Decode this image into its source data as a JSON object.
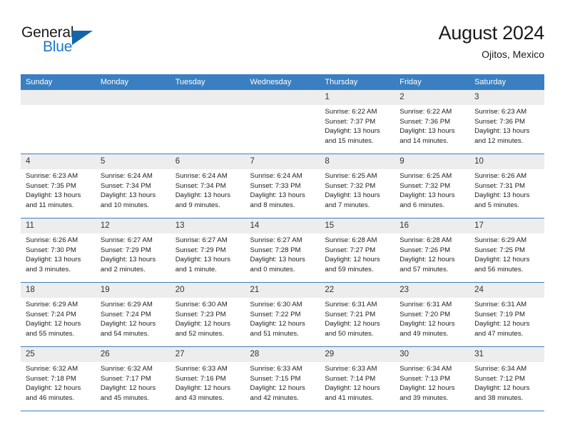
{
  "brand": {
    "line1": "General",
    "line2": "Blue",
    "triangle_icon": "blue-triangle-icon",
    "color_dark": "#1a1a1a",
    "color_blue": "#1e78c8"
  },
  "header": {
    "title": "August 2024",
    "subtitle": "Ojitos, Mexico"
  },
  "theme": {
    "header_row_bg": "#3a7fc1",
    "daynum_bg": "#ededed",
    "grid_line": "#3a7fc1",
    "text": "#222222"
  },
  "weekdays": [
    "Sunday",
    "Monday",
    "Tuesday",
    "Wednesday",
    "Thursday",
    "Friday",
    "Saturday"
  ],
  "weeks": [
    [
      {
        "day": "",
        "blank": true
      },
      {
        "day": "",
        "blank": true
      },
      {
        "day": "",
        "blank": true
      },
      {
        "day": "",
        "blank": true
      },
      {
        "day": "1",
        "sunrise": "Sunrise: 6:22 AM",
        "sunset": "Sunset: 7:37 PM",
        "daylight1": "Daylight: 13 hours",
        "daylight2": "and 15 minutes."
      },
      {
        "day": "2",
        "sunrise": "Sunrise: 6:22 AM",
        "sunset": "Sunset: 7:36 PM",
        "daylight1": "Daylight: 13 hours",
        "daylight2": "and 14 minutes."
      },
      {
        "day": "3",
        "sunrise": "Sunrise: 6:23 AM",
        "sunset": "Sunset: 7:36 PM",
        "daylight1": "Daylight: 13 hours",
        "daylight2": "and 12 minutes."
      }
    ],
    [
      {
        "day": "4",
        "sunrise": "Sunrise: 6:23 AM",
        "sunset": "Sunset: 7:35 PM",
        "daylight1": "Daylight: 13 hours",
        "daylight2": "and 11 minutes."
      },
      {
        "day": "5",
        "sunrise": "Sunrise: 6:24 AM",
        "sunset": "Sunset: 7:34 PM",
        "daylight1": "Daylight: 13 hours",
        "daylight2": "and 10 minutes."
      },
      {
        "day": "6",
        "sunrise": "Sunrise: 6:24 AM",
        "sunset": "Sunset: 7:34 PM",
        "daylight1": "Daylight: 13 hours",
        "daylight2": "and 9 minutes."
      },
      {
        "day": "7",
        "sunrise": "Sunrise: 6:24 AM",
        "sunset": "Sunset: 7:33 PM",
        "daylight1": "Daylight: 13 hours",
        "daylight2": "and 8 minutes."
      },
      {
        "day": "8",
        "sunrise": "Sunrise: 6:25 AM",
        "sunset": "Sunset: 7:32 PM",
        "daylight1": "Daylight: 13 hours",
        "daylight2": "and 7 minutes."
      },
      {
        "day": "9",
        "sunrise": "Sunrise: 6:25 AM",
        "sunset": "Sunset: 7:32 PM",
        "daylight1": "Daylight: 13 hours",
        "daylight2": "and 6 minutes."
      },
      {
        "day": "10",
        "sunrise": "Sunrise: 6:26 AM",
        "sunset": "Sunset: 7:31 PM",
        "daylight1": "Daylight: 13 hours",
        "daylight2": "and 5 minutes."
      }
    ],
    [
      {
        "day": "11",
        "sunrise": "Sunrise: 6:26 AM",
        "sunset": "Sunset: 7:30 PM",
        "daylight1": "Daylight: 13 hours",
        "daylight2": "and 3 minutes."
      },
      {
        "day": "12",
        "sunrise": "Sunrise: 6:27 AM",
        "sunset": "Sunset: 7:29 PM",
        "daylight1": "Daylight: 13 hours",
        "daylight2": "and 2 minutes."
      },
      {
        "day": "13",
        "sunrise": "Sunrise: 6:27 AM",
        "sunset": "Sunset: 7:29 PM",
        "daylight1": "Daylight: 13 hours",
        "daylight2": "and 1 minute."
      },
      {
        "day": "14",
        "sunrise": "Sunrise: 6:27 AM",
        "sunset": "Sunset: 7:28 PM",
        "daylight1": "Daylight: 13 hours",
        "daylight2": "and 0 minutes."
      },
      {
        "day": "15",
        "sunrise": "Sunrise: 6:28 AM",
        "sunset": "Sunset: 7:27 PM",
        "daylight1": "Daylight: 12 hours",
        "daylight2": "and 59 minutes."
      },
      {
        "day": "16",
        "sunrise": "Sunrise: 6:28 AM",
        "sunset": "Sunset: 7:26 PM",
        "daylight1": "Daylight: 12 hours",
        "daylight2": "and 57 minutes."
      },
      {
        "day": "17",
        "sunrise": "Sunrise: 6:29 AM",
        "sunset": "Sunset: 7:25 PM",
        "daylight1": "Daylight: 12 hours",
        "daylight2": "and 56 minutes."
      }
    ],
    [
      {
        "day": "18",
        "sunrise": "Sunrise: 6:29 AM",
        "sunset": "Sunset: 7:24 PM",
        "daylight1": "Daylight: 12 hours",
        "daylight2": "and 55 minutes."
      },
      {
        "day": "19",
        "sunrise": "Sunrise: 6:29 AM",
        "sunset": "Sunset: 7:24 PM",
        "daylight1": "Daylight: 12 hours",
        "daylight2": "and 54 minutes."
      },
      {
        "day": "20",
        "sunrise": "Sunrise: 6:30 AM",
        "sunset": "Sunset: 7:23 PM",
        "daylight1": "Daylight: 12 hours",
        "daylight2": "and 52 minutes."
      },
      {
        "day": "21",
        "sunrise": "Sunrise: 6:30 AM",
        "sunset": "Sunset: 7:22 PM",
        "daylight1": "Daylight: 12 hours",
        "daylight2": "and 51 minutes."
      },
      {
        "day": "22",
        "sunrise": "Sunrise: 6:31 AM",
        "sunset": "Sunset: 7:21 PM",
        "daylight1": "Daylight: 12 hours",
        "daylight2": "and 50 minutes."
      },
      {
        "day": "23",
        "sunrise": "Sunrise: 6:31 AM",
        "sunset": "Sunset: 7:20 PM",
        "daylight1": "Daylight: 12 hours",
        "daylight2": "and 49 minutes."
      },
      {
        "day": "24",
        "sunrise": "Sunrise: 6:31 AM",
        "sunset": "Sunset: 7:19 PM",
        "daylight1": "Daylight: 12 hours",
        "daylight2": "and 47 minutes."
      }
    ],
    [
      {
        "day": "25",
        "sunrise": "Sunrise: 6:32 AM",
        "sunset": "Sunset: 7:18 PM",
        "daylight1": "Daylight: 12 hours",
        "daylight2": "and 46 minutes."
      },
      {
        "day": "26",
        "sunrise": "Sunrise: 6:32 AM",
        "sunset": "Sunset: 7:17 PM",
        "daylight1": "Daylight: 12 hours",
        "daylight2": "and 45 minutes."
      },
      {
        "day": "27",
        "sunrise": "Sunrise: 6:33 AM",
        "sunset": "Sunset: 7:16 PM",
        "daylight1": "Daylight: 12 hours",
        "daylight2": "and 43 minutes."
      },
      {
        "day": "28",
        "sunrise": "Sunrise: 6:33 AM",
        "sunset": "Sunset: 7:15 PM",
        "daylight1": "Daylight: 12 hours",
        "daylight2": "and 42 minutes."
      },
      {
        "day": "29",
        "sunrise": "Sunrise: 6:33 AM",
        "sunset": "Sunset: 7:14 PM",
        "daylight1": "Daylight: 12 hours",
        "daylight2": "and 41 minutes."
      },
      {
        "day": "30",
        "sunrise": "Sunrise: 6:34 AM",
        "sunset": "Sunset: 7:13 PM",
        "daylight1": "Daylight: 12 hours",
        "daylight2": "and 39 minutes."
      },
      {
        "day": "31",
        "sunrise": "Sunrise: 6:34 AM",
        "sunset": "Sunset: 7:12 PM",
        "daylight1": "Daylight: 12 hours",
        "daylight2": "and 38 minutes."
      }
    ]
  ]
}
